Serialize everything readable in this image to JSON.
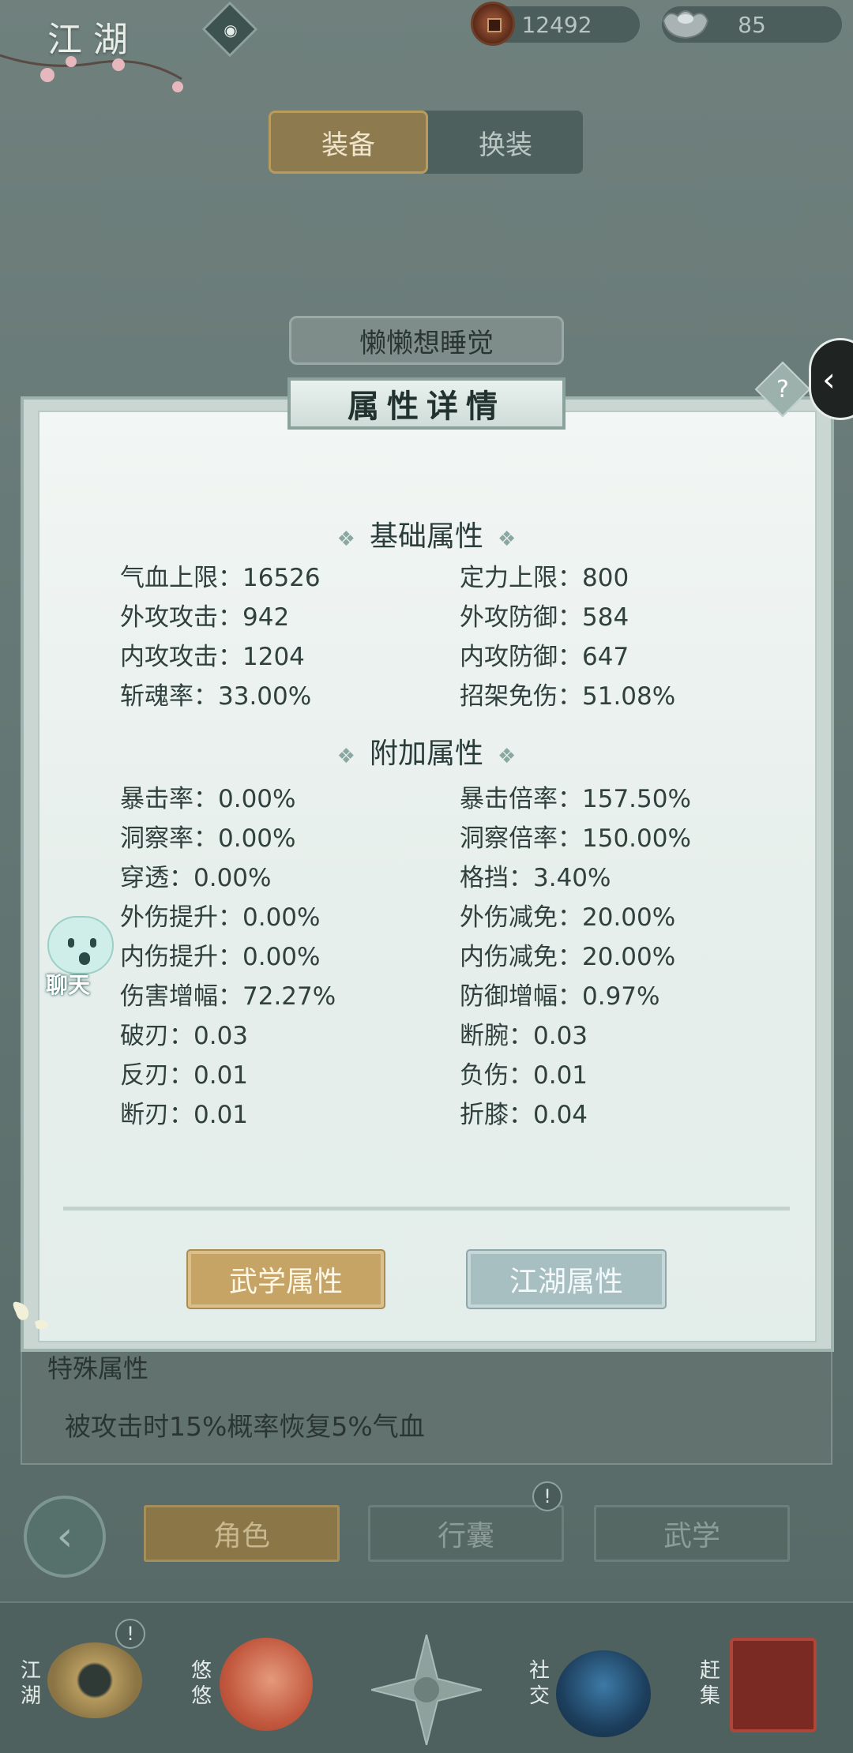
{
  "topbar": {
    "title": "江湖",
    "copper": "12492",
    "silver": "85"
  },
  "tabs": [
    {
      "label": "装备",
      "active": true
    },
    {
      "label": "换装",
      "active": false
    }
  ],
  "character": {
    "name": "懒懒想睡觉"
  },
  "modal": {
    "title": "属性详情",
    "help": "?",
    "basic_heading": "基础属性",
    "basic": [
      "气血上限：16526",
      "定力上限：800",
      "外攻攻击：942",
      "外攻防御：584",
      "内攻攻击：1204",
      "内攻防御：647",
      "斩魂率：33.00%",
      "招架免伤：51.08%"
    ],
    "extra_heading": "附加属性",
    "extra": [
      "暴击率：0.00%",
      "暴击倍率：157.50%",
      "洞察率：0.00%",
      "洞察倍率：150.00%",
      "穿透：0.00%",
      "格挡：3.40%",
      "外伤提升：0.00%",
      "外伤减免：20.00%",
      "内伤提升：0.00%",
      "内伤减免：20.00%",
      "伤害增幅：72.27%",
      "防御增幅：0.97%",
      "破刃：0.03",
      "断腕：0.03",
      "反刃：0.01",
      "负伤：0.01",
      "断刃：0.01",
      "折膝：0.04"
    ],
    "btn_martial": "武学属性",
    "btn_jianghu": "江湖属性"
  },
  "chat": {
    "label": "聊天"
  },
  "special": {
    "title": "特殊属性",
    "text": "被攻击时15%概率恢复5%气血"
  },
  "nav": {
    "role": "角色",
    "bag": "行囊",
    "skill": "武学",
    "bang": "!"
  },
  "bottom": {
    "jianghu": "江湖",
    "youyou": "悠悠",
    "social": "社交",
    "market": "赶集",
    "bang": "!"
  },
  "colors": {
    "gold_button": "#c6a466",
    "blue_button": "#a7bfc1",
    "panel": "#e7efec"
  }
}
